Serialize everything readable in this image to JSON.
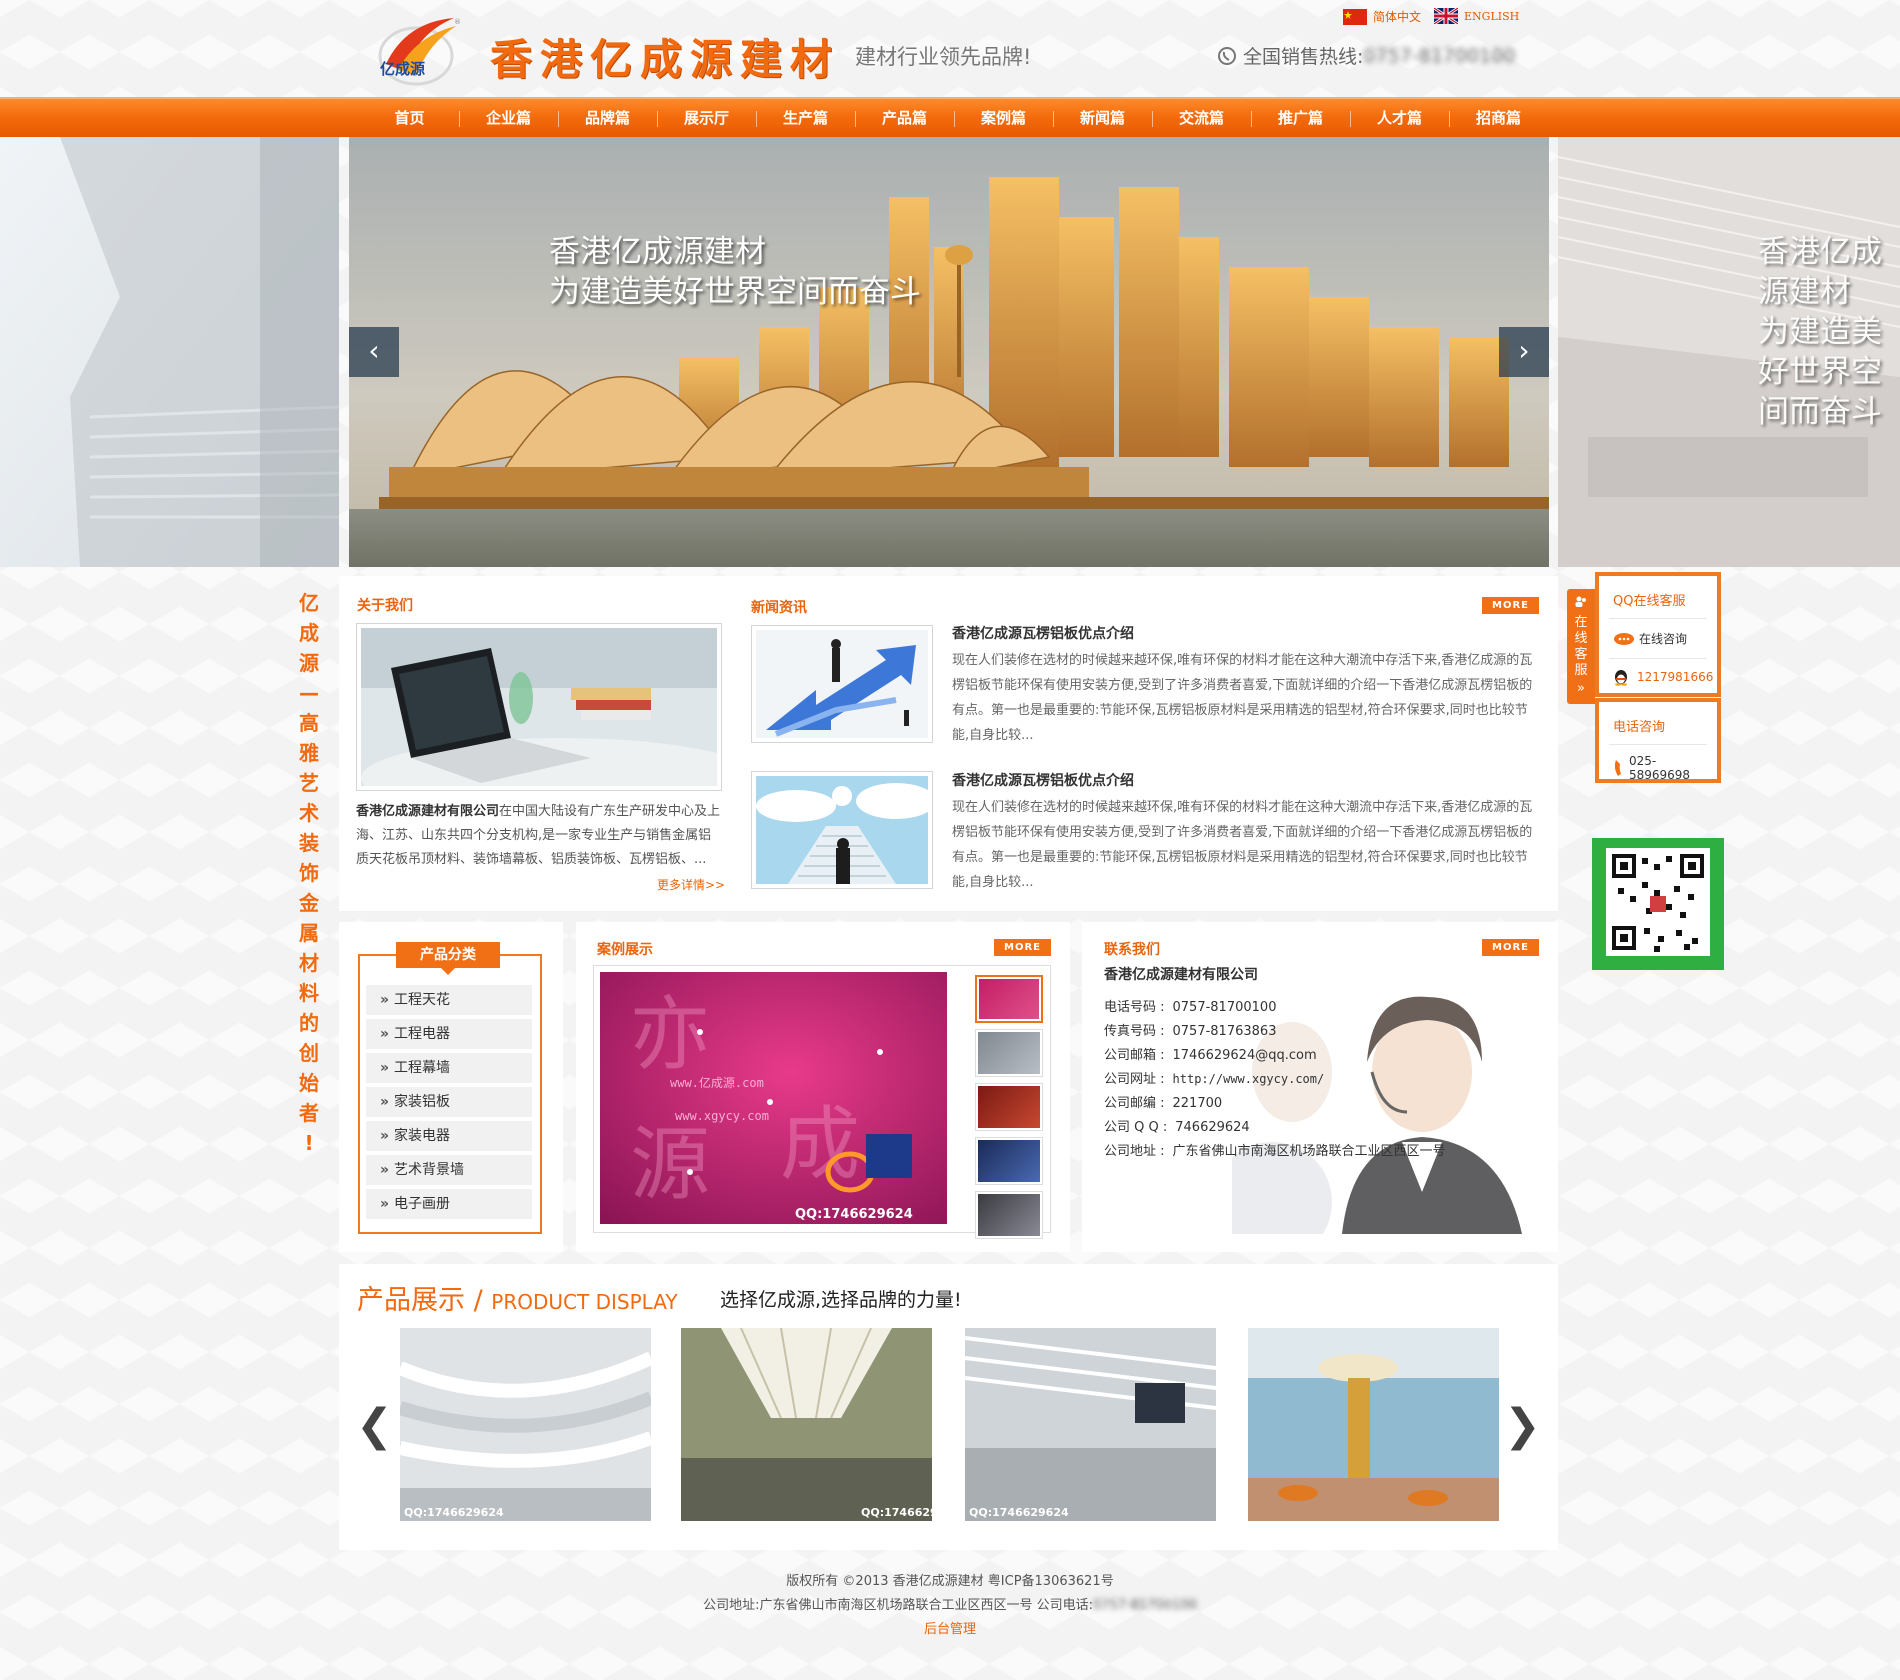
{
  "header": {
    "logo_text": "亿成源",
    "company_name": "香港亿成源建材",
    "slogan": "建材行业领先品牌!",
    "lang_cn": "简体中文",
    "lang_en": "ENGLISH",
    "hotline_label": "全国销售热线:",
    "hotline_number": "0757-81700100"
  },
  "nav": [
    "首页",
    "企业篇",
    "品牌篇",
    "展示厅",
    "生产篇",
    "产品篇",
    "案例篇",
    "新闻篇",
    "交流篇",
    "推广篇",
    "人才篇",
    "招商篇"
  ],
  "banner": {
    "line1": "香港亿成源建材",
    "line2": "为建造美好世界空间而奋斗",
    "prev": "‹",
    "next": "›"
  },
  "vertical_slogan": [
    "亿",
    "成",
    "源",
    "—",
    "高",
    "雅",
    "艺",
    "术",
    "装",
    "饰",
    "金",
    "属",
    "材",
    "料",
    "的",
    "创",
    "始",
    "者",
    "!"
  ],
  "about": {
    "title": "关于我们",
    "company": "香港亿成源建材有限公司",
    "text": "在中国大陆设有广东生产研发中心及上海、江苏、山东共四个分支机构,是一家专业生产与销售金属铝质天花板吊顶材料、装饰墙幕板、铝质装饰板、瓦楞铝板、...",
    "readmore": "更多详情>>"
  },
  "news": {
    "title": "新闻资讯",
    "more": "MORE",
    "items": [
      {
        "title": "香港亿成源瓦楞铝板优点介绍",
        "body": "现在人们装修在选材的时候越来越环保,唯有环保的材料才能在这种大潮流中存活下来,香港亿成源的瓦楞铝板节能环保有使用安装方便,受到了许多消费者喜爱,下面就详细的介绍一下香港亿成源瓦楞铝板的有点。第一也是最重要的:节能环保,瓦楞铝板原材料是采用精选的铝型材,符合环保要求,同时也比较节能,自身比较..."
      },
      {
        "title": "香港亿成源瓦楞铝板优点介绍",
        "body": "现在人们装修在选材的时候越来越环保,唯有环保的材料才能在这种大潮流中存活下来,香港亿成源的瓦楞铝板节能环保有使用安装方便,受到了许多消费者喜爱,下面就详细的介绍一下香港亿成源瓦楞铝板的有点。第一也是最重要的:节能环保,瓦楞铝板原材料是采用精选的铝型材,符合环保要求,同时也比较节能,自身比较..."
      }
    ]
  },
  "categories": {
    "title": "产品分类",
    "items": [
      "工程天花",
      "工程电器",
      "工程幕墙",
      "家装铝板",
      "家装电器",
      "艺术背景墙",
      "电子画册"
    ]
  },
  "cases": {
    "title": "案例展示",
    "more": "MORE",
    "watermark1": "www.亿成源.com",
    "watermark2": "www.xgycy.com",
    "qq": "QQ:1746629624"
  },
  "contact": {
    "title": "联系我们",
    "more": "MORE",
    "company": "香港亿成源建材有限公司",
    "lines": [
      {
        "label": "电话号码 :",
        "value": "0757-81700100"
      },
      {
        "label": "传真号码 :",
        "value": "0757-81763863"
      },
      {
        "label": "公司邮箱 :",
        "value": "1746629624@qq.com"
      },
      {
        "label": "公司网址 :",
        "value": "http://www.xgycy.com/"
      },
      {
        "label": "公司邮编 :",
        "value": "221700"
      },
      {
        "label": "公司 Q Q :",
        "value": "746629624"
      },
      {
        "label": "公司地址 :",
        "value": "广东省佛山市南海区机场路联合工业区西区一号"
      }
    ]
  },
  "product_display": {
    "title_cn": "产品展示",
    "separator": "/",
    "title_en": "PRODUCT DISPLAY",
    "slogan": "选择亿成源,选择品牌的力量!",
    "qq": "QQ:1746629624",
    "prev": "❮",
    "next": "❯"
  },
  "footer": {
    "line1": "版权所有 ©2013 香港亿成源建材 粤ICP备13063621号",
    "line2_prefix": "公司地址:广东省佛山市南海区机场路联合工业区西区一号  公司电话:",
    "line2_phone": "0757-81700100",
    "admin": "后台管理"
  },
  "kefu": {
    "tab": "在线客服",
    "qq_title": "QQ在线客服",
    "online": "在线咨询",
    "qq_number": "1217981666",
    "phone_title": "电话咨询",
    "phone": "025-58969698"
  },
  "colors": {
    "brand_orange": "#f26a10",
    "nav_gradient_top": "#ff8a2a",
    "nav_gradient_bottom": "#e85a00"
  }
}
